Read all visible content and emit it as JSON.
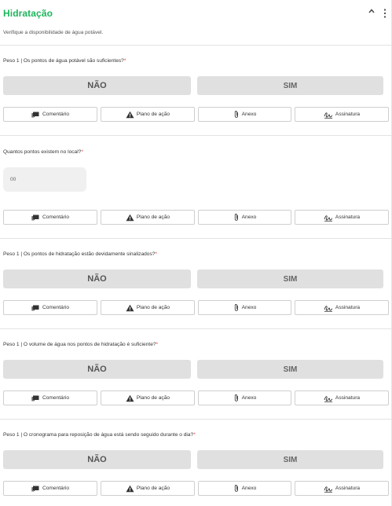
{
  "header": {
    "title": "Hidratação",
    "description": "Verifique a disponibilidade de água potável."
  },
  "actions": {
    "comment": "Comentário",
    "action_plan": "Plano de ação",
    "attachment": "Anexo",
    "signature": "Assinatura"
  },
  "answers": {
    "no": "NÃO",
    "yes": "SIM"
  },
  "questions": [
    {
      "text": "Peso 1 | Os pontos de água potável são suficientes?",
      "required": "*"
    },
    {
      "text": "Quantos pontos existem no local?",
      "required": "*",
      "value": "00"
    },
    {
      "text": "Peso 1 | Os pontos de hidratação estão devidamente sinalizados?",
      "required": "*"
    },
    {
      "text": "Peso 1 | O volume de água nos pontos de hidratação é suficiente?",
      "required": "*"
    },
    {
      "text": "Peso 1 | O cronograma para reposição de água está sendo seguido durante o dia?",
      "required": "*"
    }
  ],
  "colors": {
    "title": "#1db55c",
    "required": "#e53935",
    "button": "#e0e0e0"
  },
  "icons": [
    "chevron-up-icon",
    "kebab-menu-icon",
    "comment-icon",
    "warning-icon",
    "paperclip-icon",
    "signature-icon"
  ]
}
